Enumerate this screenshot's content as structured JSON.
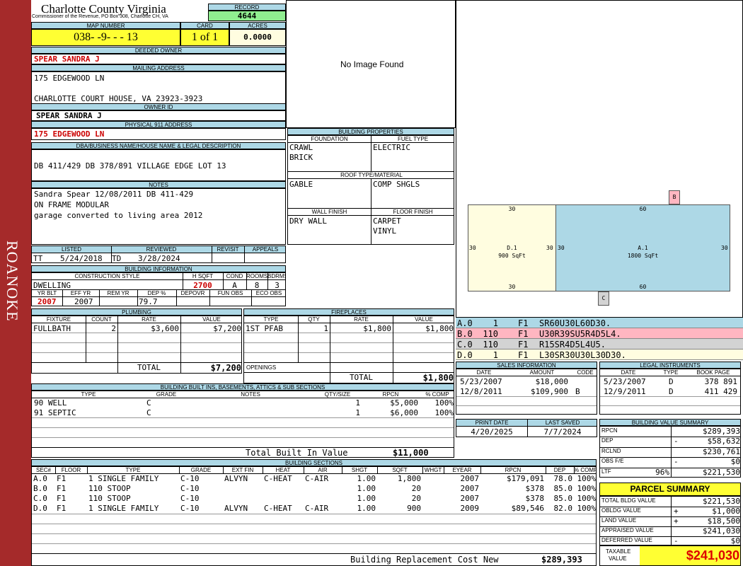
{
  "county": {
    "title": "Charlotte County Virginia",
    "subtitle": "Commissioner of the Revenue, PO Box 308, Charlotte CH, VA",
    "side_text": "ROANOKE"
  },
  "record": {
    "label": "RECORD",
    "value": "4644"
  },
  "map": {
    "label": "MAP NUMBER",
    "value": "038- -9- - - 13",
    "card_label": "CARD",
    "card": "1 of 1",
    "acres_label": "ACRES",
    "acres": "0.0000"
  },
  "owner": {
    "deeded_label": "DEEDED OWNER",
    "deeded": "SPEAR SANDRA J",
    "mailing_label": "MAILING ADDRESS",
    "mail1": "175 EDGEWOOD LN",
    "mail2": "CHARLOTTE COURT HOUSE, VA 23923-3923",
    "owner_id_label": "OWNER ID",
    "owner_id": "SPEAR SANDRA J",
    "phys_label": "PHYSICAL 911 ADDRESS",
    "phys": "175 EDGEWOOD LN"
  },
  "legal": {
    "label": "DBA/BUSINESS NAME/HOUSE NAME & LEGAL DESCRIPTION",
    "value": "DB 411/429 DB 378/891 VILLAGE EDGE LOT 13"
  },
  "notes": {
    "label": "NOTES",
    "lines": [
      "Sandra Spear  12/08/2011 DB 411-429",
      "ON FRAME MODULAR",
      "garage converted to living area 2012"
    ]
  },
  "image": {
    "text": "No Image Found"
  },
  "building_props": {
    "label": "BUILDING PROPERTIES",
    "foundation_label": "FOUNDATION",
    "foundation1": "CRAWL",
    "foundation2": "BRICK",
    "fuel_label": "FUEL TYPE",
    "fuel": "ELECTRIC",
    "roof_label": "ROOF TYPE/MATERIAL",
    "roof_type": "GABLE",
    "roof_mat": "COMP SHGLS",
    "wall_label": "WALL FINISH",
    "wall": "DRY WALL",
    "floor_label": "FLOOR FINISH",
    "floor1": "CARPET",
    "floor2": "VINYL"
  },
  "status": {
    "listed_label": "LISTED",
    "listed_code": "TT",
    "listed": "5/24/2018",
    "reviewed_label": "REVIEWED",
    "reviewed_code": "TD",
    "reviewed": "3/28/2024",
    "revisit_label": "REVISIT",
    "appeals_label": "APPEALS"
  },
  "building_info": {
    "label": "BUILDING INFORMATION",
    "cs_label": "CONSTRUCTION STYLE",
    "cs": "DWELLING",
    "hsqft_label": "H SQFT",
    "hsqft": "2700",
    "cond_label": "COND",
    "cond": "A",
    "rooms_label": "ROOMS",
    "rooms": "8",
    "bdrms_label": "BDRMS",
    "bdrms": "3",
    "yrblt_label": "YR BLT",
    "yrblt": "2007",
    "effyr_label": "EFF YR",
    "effyr": "2007",
    "remyr_label": "REM YR",
    "dep_label": "DEP %",
    "dep": "79.7",
    "depovr_label": "DEPOVR",
    "funobs_label": "FUN OBS",
    "ecoobs_label": "ECO OBS"
  },
  "plumbing": {
    "label": "PLUMBING",
    "h_fixture": "FIXTURE",
    "h_count": "COUNT",
    "h_rate": "RATE",
    "h_value": "VALUE",
    "fixture": "FULLBATH",
    "count": "2",
    "rate": "$3,600",
    "value": "$7,200",
    "total_label": "TOTAL",
    "total": "$7,200"
  },
  "fireplaces": {
    "label": "FIREPLACES",
    "h_type": "TYPE",
    "h_qty": "QTY",
    "h_rate": "RATE",
    "h_value": "VALUE",
    "type": "1ST PFAB",
    "qty": "1",
    "rate": "$1,800",
    "value": "$1,800",
    "openings_label": "OPENINGS",
    "total_label": "TOTAL",
    "total": "$1,800"
  },
  "sketch": {
    "d_label": "D.1",
    "d_area": "900 SqFt",
    "a_label": "A.1",
    "a_area": "1800 SqFt",
    "d_top": "30",
    "d_bottom": "30",
    "d_left": "30",
    "d_right": "30",
    "a_top": "60",
    "a_bottom": "60",
    "a_left": "30",
    "a_right": "30",
    "b": "B",
    "c": "C"
  },
  "sections_codes": [
    {
      "code": "A.0",
      "n": "1",
      "f": "F1",
      "path": "SR60U30L60D30.",
      "color": "#add8e6"
    },
    {
      "code": "B.0",
      "n": "110",
      "f": "F1",
      "path": "U30R39SU5R4D5L4.",
      "color": "#ffb6c1"
    },
    {
      "code": "C.0",
      "n": "110",
      "f": "F1",
      "path": "R15SR4D5L4U5.",
      "color": "#d3d3d3"
    },
    {
      "code": "D.0",
      "n": "1",
      "f": "F1",
      "path": "L30SR30U30L30D30.",
      "color": "#fffde0"
    }
  ],
  "sales": {
    "label": "SALES INFORMATION",
    "h_date": "DATE",
    "h_amount": "AMOUNT",
    "h_code": "CODE",
    "rows": [
      {
        "date": "5/23/2007",
        "amount": "$18,000",
        "code": ""
      },
      {
        "date": "12/8/2011",
        "amount": "$109,900",
        "code": "B"
      }
    ]
  },
  "legal_instr": {
    "label": "LEGAL INSTRUMENTS",
    "h_date": "DATE",
    "h_type": "TYPE",
    "h_book": "BOOK PAGE",
    "rows": [
      {
        "date": "5/23/2007",
        "type": "D",
        "book": "378 891"
      },
      {
        "date": "12/9/2011",
        "type": "D",
        "book": "411 429"
      }
    ]
  },
  "print": {
    "print_label": "PRINT DATE",
    "print": "4/20/2025",
    "saved_label": "LAST SAVED",
    "saved": "7/7/2024"
  },
  "bvs": {
    "label": "BUILDING VALUE SUMMARY",
    "rows": [
      {
        "k": "RPCN",
        "s": "",
        "v": "$289,393"
      },
      {
        "k": "DEP",
        "s": "-",
        "v": "$58,632"
      },
      {
        "k": "RCLND",
        "s": "",
        "v": "$230,761"
      },
      {
        "k": "OBS F/E",
        "s": "-",
        "v": "$0"
      },
      {
        "k": "LTF",
        "p": "96%",
        "s": "",
        "v": "$221,530"
      }
    ]
  },
  "parcel": {
    "label": "PARCEL SUMMARY",
    "rows": [
      {
        "k": "TOTAL BLDG VALUE",
        "s": "",
        "v": "$221,530"
      },
      {
        "k": "OBLDG VALUE",
        "s": "+",
        "v": "$1,000"
      },
      {
        "k": "LAND VALUE",
        "s": "+",
        "v": "$18,500"
      },
      {
        "k": "APPRAISED VALUE",
        "s": "",
        "v": "$241,030"
      },
      {
        "k": "DEFERRED VALUE",
        "s": "-",
        "v": "$0"
      }
    ],
    "taxable_label1": "TAXABLE",
    "taxable_label2": "VALUE",
    "taxable": "$241,030"
  },
  "builtins": {
    "label": "BUILDING BUILT INS, BASEMENTS, ATTICS & SUB SECTIONS",
    "h_type": "TYPE",
    "h_grade": "GRADE",
    "h_notes": "NOTES",
    "h_qty": "QTY/SIZE",
    "h_rpcn": "RPCN",
    "h_comp": "% COMP",
    "rows": [
      {
        "type": "90 WELL",
        "grade": "C",
        "qty": "1",
        "rpcn": "$5,000",
        "comp": "100%"
      },
      {
        "type": "91 SEPTIC",
        "grade": "C",
        "qty": "1",
        "rpcn": "$6,000",
        "comp": "100%"
      }
    ],
    "total_label": "Total Built In Value",
    "total": "$11,000"
  },
  "sections": {
    "label": "BUILDING SECTIONS",
    "h": [
      "SEC#",
      "FLOOR",
      "TYPE",
      "GRADE",
      "EXT FIN",
      "HEAT",
      "AIR",
      "SHGT",
      "SQFT",
      "WHGT",
      "EYEAR",
      "RPCN",
      "DEP",
      "% COMP"
    ],
    "rows": [
      {
        "sec": "A.0",
        "floor": "F1",
        "type": "1 SINGLE FAMILY",
        "grade": "C-10",
        "ext": "ALVYN",
        "heat": "C-HEAT",
        "air": "C-AIR",
        "shgt": "1.00",
        "sqft": "1,800",
        "whgt": "",
        "eyear": "2007",
        "rpcn": "$179,091",
        "dep": "78.0",
        "comp": "100%"
      },
      {
        "sec": "B.0",
        "floor": "F1",
        "type": "110 STOOP",
        "grade": "C-10",
        "ext": "",
        "heat": "",
        "air": "",
        "shgt": "1.00",
        "sqft": "20",
        "whgt": "",
        "eyear": "2007",
        "rpcn": "$378",
        "dep": "85.0",
        "comp": "100%"
      },
      {
        "sec": "C.0",
        "floor": "F1",
        "type": "110 STOOP",
        "grade": "C-10",
        "ext": "",
        "heat": "",
        "air": "",
        "shgt": "1.00",
        "sqft": "20",
        "whgt": "",
        "eyear": "2007",
        "rpcn": "$378",
        "dep": "85.0",
        "comp": "100%"
      },
      {
        "sec": "D.0",
        "floor": "F1",
        "type": "1 SINGLE FAMILY",
        "grade": "C-10",
        "ext": "ALVYN",
        "heat": "C-HEAT",
        "air": "C-AIR",
        "shgt": "1.00",
        "sqft": "900",
        "whgt": "",
        "eyear": "2009",
        "rpcn": "$89,546",
        "dep": "82.0",
        "comp": "100%"
      }
    ],
    "brcn_label": "Building Replacement Cost New",
    "brcn": "$289,393"
  }
}
